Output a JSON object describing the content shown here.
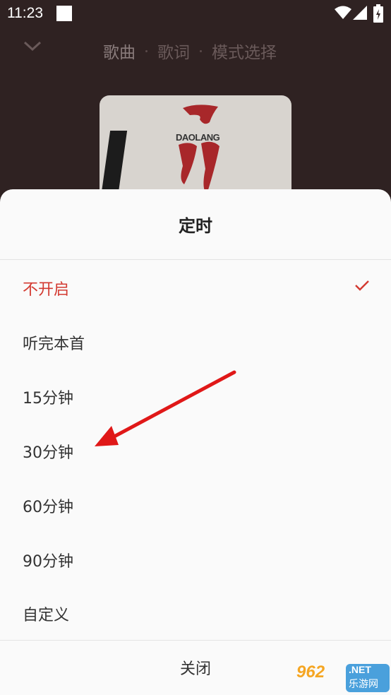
{
  "status_bar": {
    "time": "11:23"
  },
  "top_nav": {
    "tabs": [
      {
        "label": "歌曲"
      },
      {
        "label": "歌词"
      },
      {
        "label": "模式选择"
      }
    ]
  },
  "album": {
    "logo_text": "DAOLANG"
  },
  "sheet": {
    "title": "定时",
    "options": [
      {
        "label": "不开启",
        "selected": true
      },
      {
        "label": "听完本首",
        "selected": false
      },
      {
        "label": "15分钟",
        "selected": false
      },
      {
        "label": "30分钟",
        "selected": false
      },
      {
        "label": "60分钟",
        "selected": false
      },
      {
        "label": "90分钟",
        "selected": false
      },
      {
        "label": "自定义",
        "selected": false
      }
    ],
    "close_label": "关闭"
  },
  "colors": {
    "accent": "#d33a31",
    "annotation_arrow": "#e01818"
  },
  "watermark": {
    "brand": "962",
    "suffix": ".NET",
    "sub": "乐游网"
  }
}
